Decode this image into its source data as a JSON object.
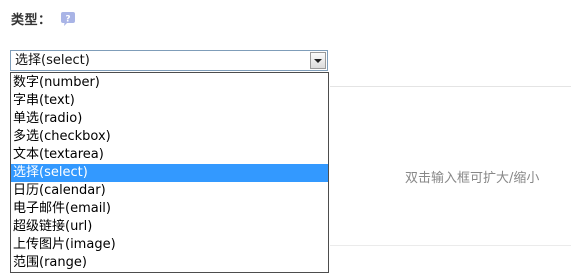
{
  "field": {
    "label": "类型：",
    "help_icon": "question-bubble-icon",
    "help_icon_color": "#a9b4e6"
  },
  "select": {
    "value": "选择(select)",
    "options": [
      "数字(number)",
      "字串(text)",
      "单选(radio)",
      "多选(checkbox)",
      "文本(textarea)",
      "选择(select)",
      "日历(calendar)",
      "电子邮件(email)",
      "超级链接(url)",
      "上传图片(image)",
      "范围(range)"
    ],
    "selected_index": 5,
    "highlight_color": "#3399ff"
  },
  "hint_text": "双击输入框可扩大/缩小"
}
